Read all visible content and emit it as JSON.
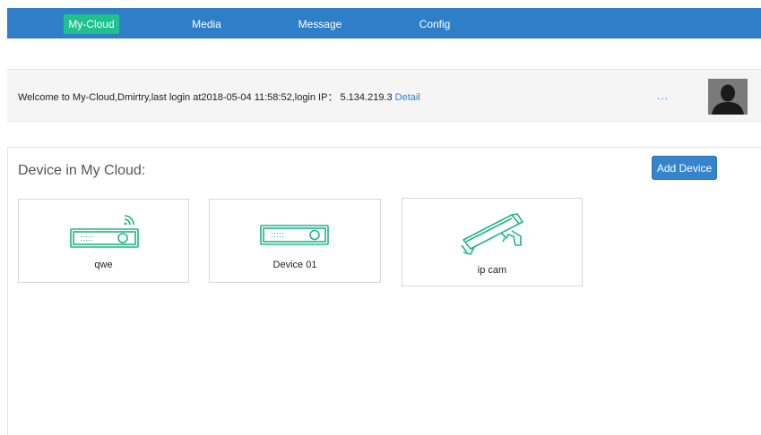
{
  "nav": {
    "items": [
      {
        "label": "My-Cloud",
        "active": true
      },
      {
        "label": "Media",
        "active": false
      },
      {
        "label": "Message",
        "active": false
      },
      {
        "label": "Config",
        "active": false
      }
    ]
  },
  "welcome": {
    "text": "Welcome to My-Cloud,Dmirtry,last login at2018-05-04 11:58:52,login IP： 5.134.219.3 ",
    "detail_link": "Detail",
    "more": "...",
    "avatar_icon": "user-avatar-icon"
  },
  "devices": {
    "title": "Device in My Cloud:",
    "add_button": "Add Device",
    "items": [
      {
        "name": "qwe",
        "icon": "wifi-nvr-icon"
      },
      {
        "name": "Device 01",
        "icon": "nvr-icon"
      },
      {
        "name": "ip cam",
        "icon": "ip-camera-icon"
      }
    ]
  },
  "colors": {
    "nav_bg": "#2f7fc8",
    "active_tab": "#1fc28e",
    "accent": "#3584cc",
    "icon_green": "#1fb585"
  }
}
